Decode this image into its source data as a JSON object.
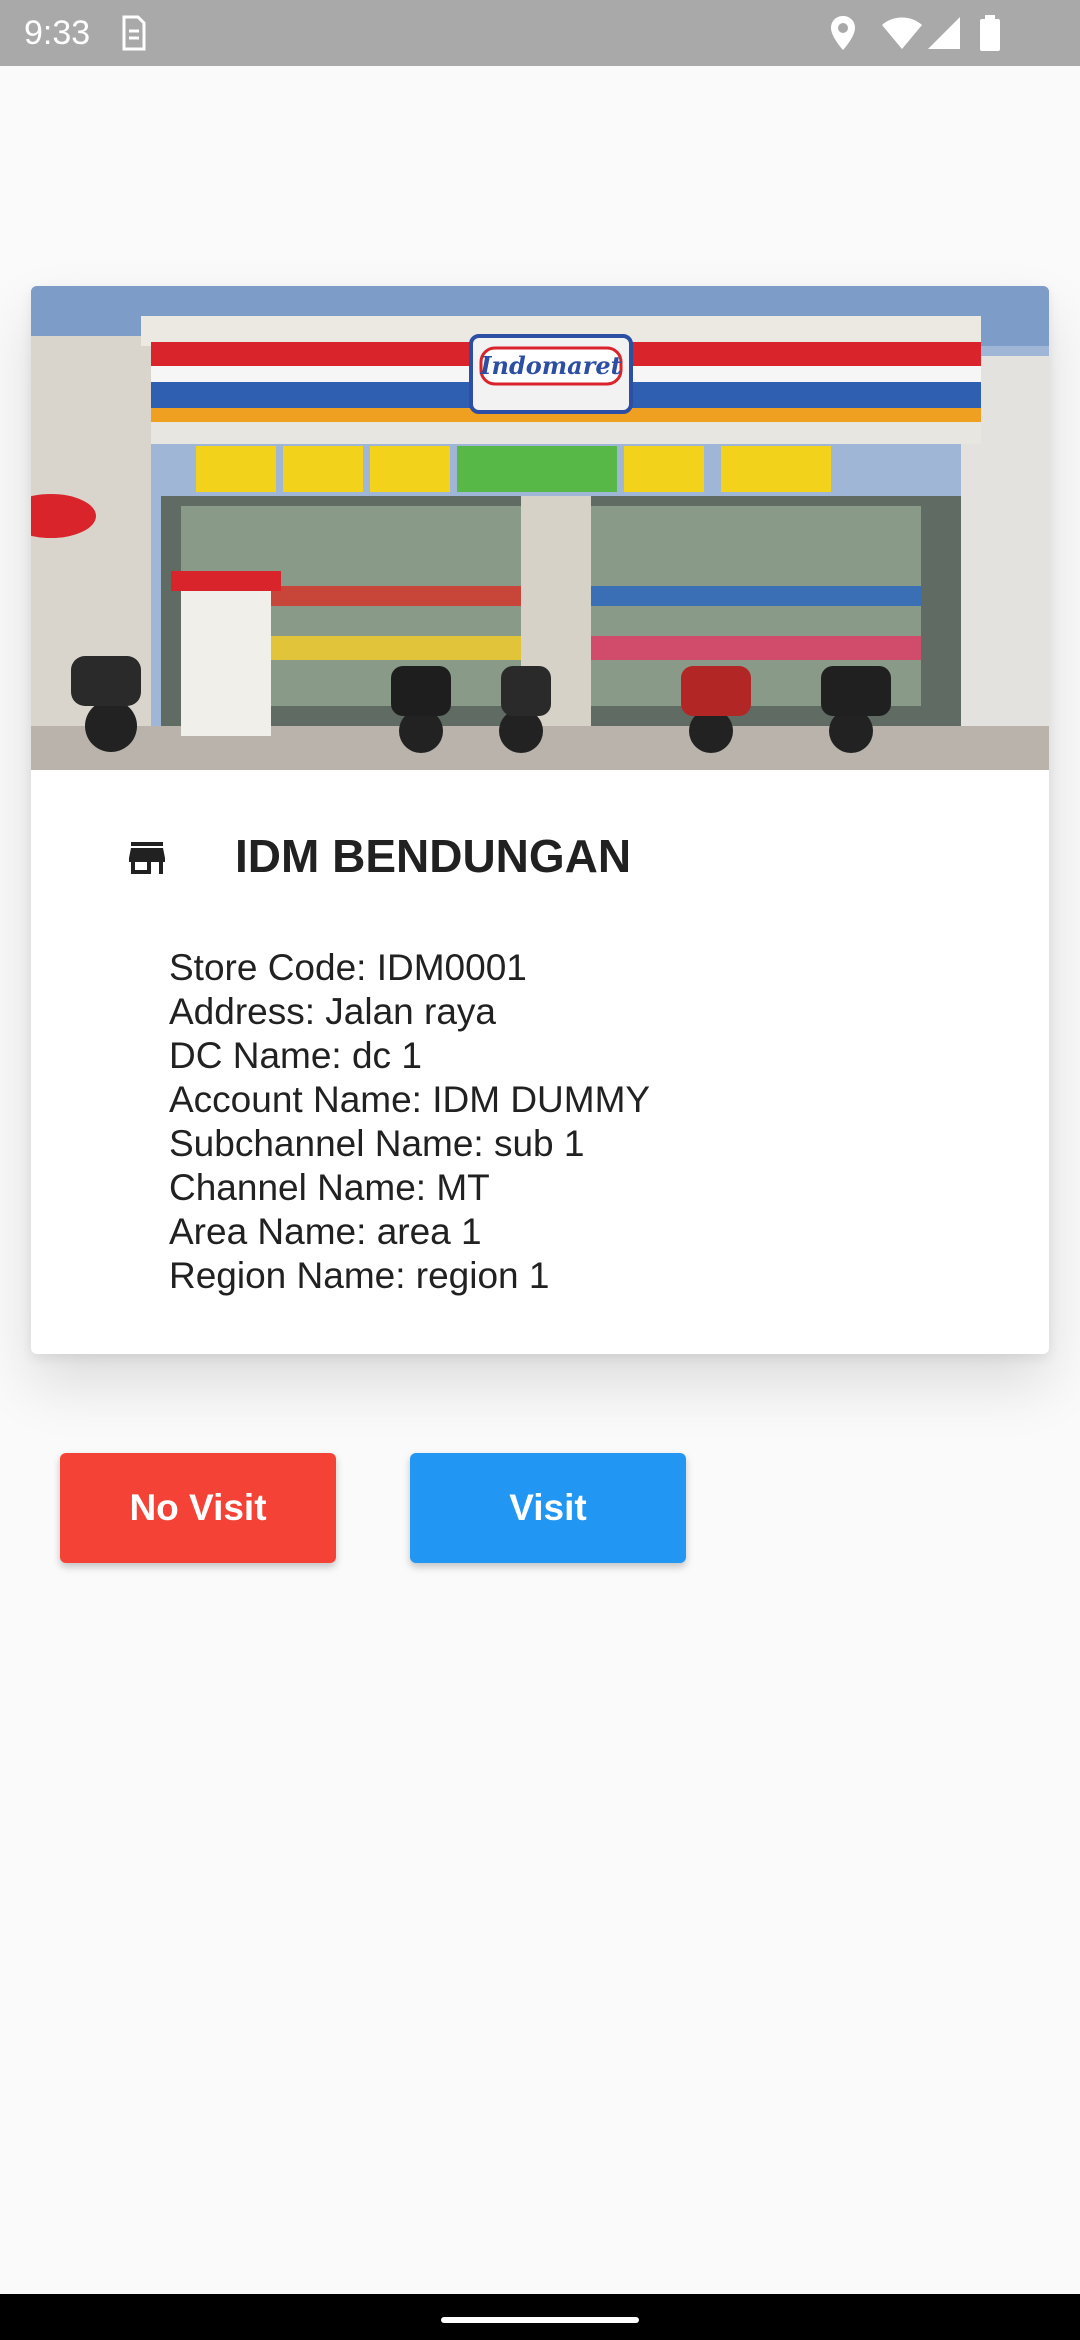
{
  "status_bar": {
    "time": "9:33",
    "icons": [
      "sim-card-icon",
      "location-icon",
      "wifi-icon",
      "signal-icon",
      "battery-icon"
    ]
  },
  "store_card": {
    "image_name": "store-front-photo",
    "icon": "store-icon",
    "title": "IDM BENDUNGAN",
    "details": [
      "Store Code: IDM0001",
      "Address: Jalan raya",
      "DC Name: dc 1",
      "Account Name: IDM DUMMY",
      "Subchannel Name: sub 1",
      "Channel Name: MT",
      "Area Name: area 1",
      "Region Name: region 1"
    ],
    "photo_sign_text": "Indomaret"
  },
  "actions": {
    "no_visit_label": "No Visit",
    "visit_label": "Visit"
  },
  "colors": {
    "no_visit": "#f44336",
    "visit": "#2196f3",
    "status_bar": "#a9a9a9",
    "background": "#fafafa"
  }
}
